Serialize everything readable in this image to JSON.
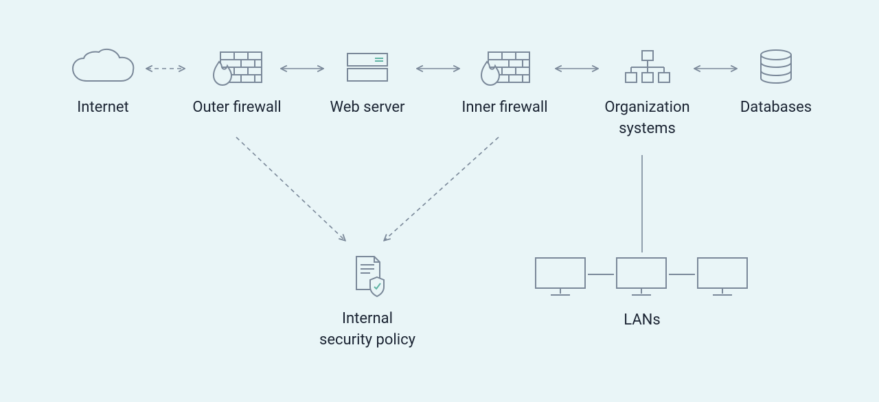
{
  "nodes": {
    "internet": {
      "label": "Internet",
      "icon": "cloud-icon"
    },
    "outer_firewall": {
      "label": "Outer firewall",
      "icon": "firewall-icon"
    },
    "web_server": {
      "label": "Web server",
      "icon": "server-icon"
    },
    "inner_firewall": {
      "label": "Inner firewall",
      "icon": "firewall-icon"
    },
    "organization_systems": {
      "label": "Organization\nsystems",
      "icon": "network-icon"
    },
    "databases": {
      "label": "Databases",
      "icon": "database-icon"
    },
    "internal_security_policy": {
      "label": "Internal\nsecurity policy",
      "icon": "policy-icon"
    },
    "lans": {
      "label": "LANs",
      "icon": "monitors-icon"
    }
  },
  "connections": [
    {
      "from": "internet",
      "to": "outer_firewall",
      "style": "dashed",
      "double_arrow": true
    },
    {
      "from": "outer_firewall",
      "to": "web_server",
      "style": "solid",
      "double_arrow": true
    },
    {
      "from": "web_server",
      "to": "inner_firewall",
      "style": "solid",
      "double_arrow": true
    },
    {
      "from": "inner_firewall",
      "to": "organization_systems",
      "style": "solid",
      "double_arrow": true
    },
    {
      "from": "organization_systems",
      "to": "databases",
      "style": "solid",
      "double_arrow": true
    },
    {
      "from": "outer_firewall",
      "to": "internal_security_policy",
      "style": "dashed",
      "double_arrow": false
    },
    {
      "from": "inner_firewall",
      "to": "internal_security_policy",
      "style": "dashed",
      "double_arrow": false
    },
    {
      "from": "organization_systems",
      "to": "lans",
      "style": "solid",
      "double_arrow": false
    }
  ],
  "colors": {
    "stroke": "#7a8899",
    "accent": "#5fb3a3",
    "text": "#1a2332",
    "bg": "#e9f5f7"
  }
}
